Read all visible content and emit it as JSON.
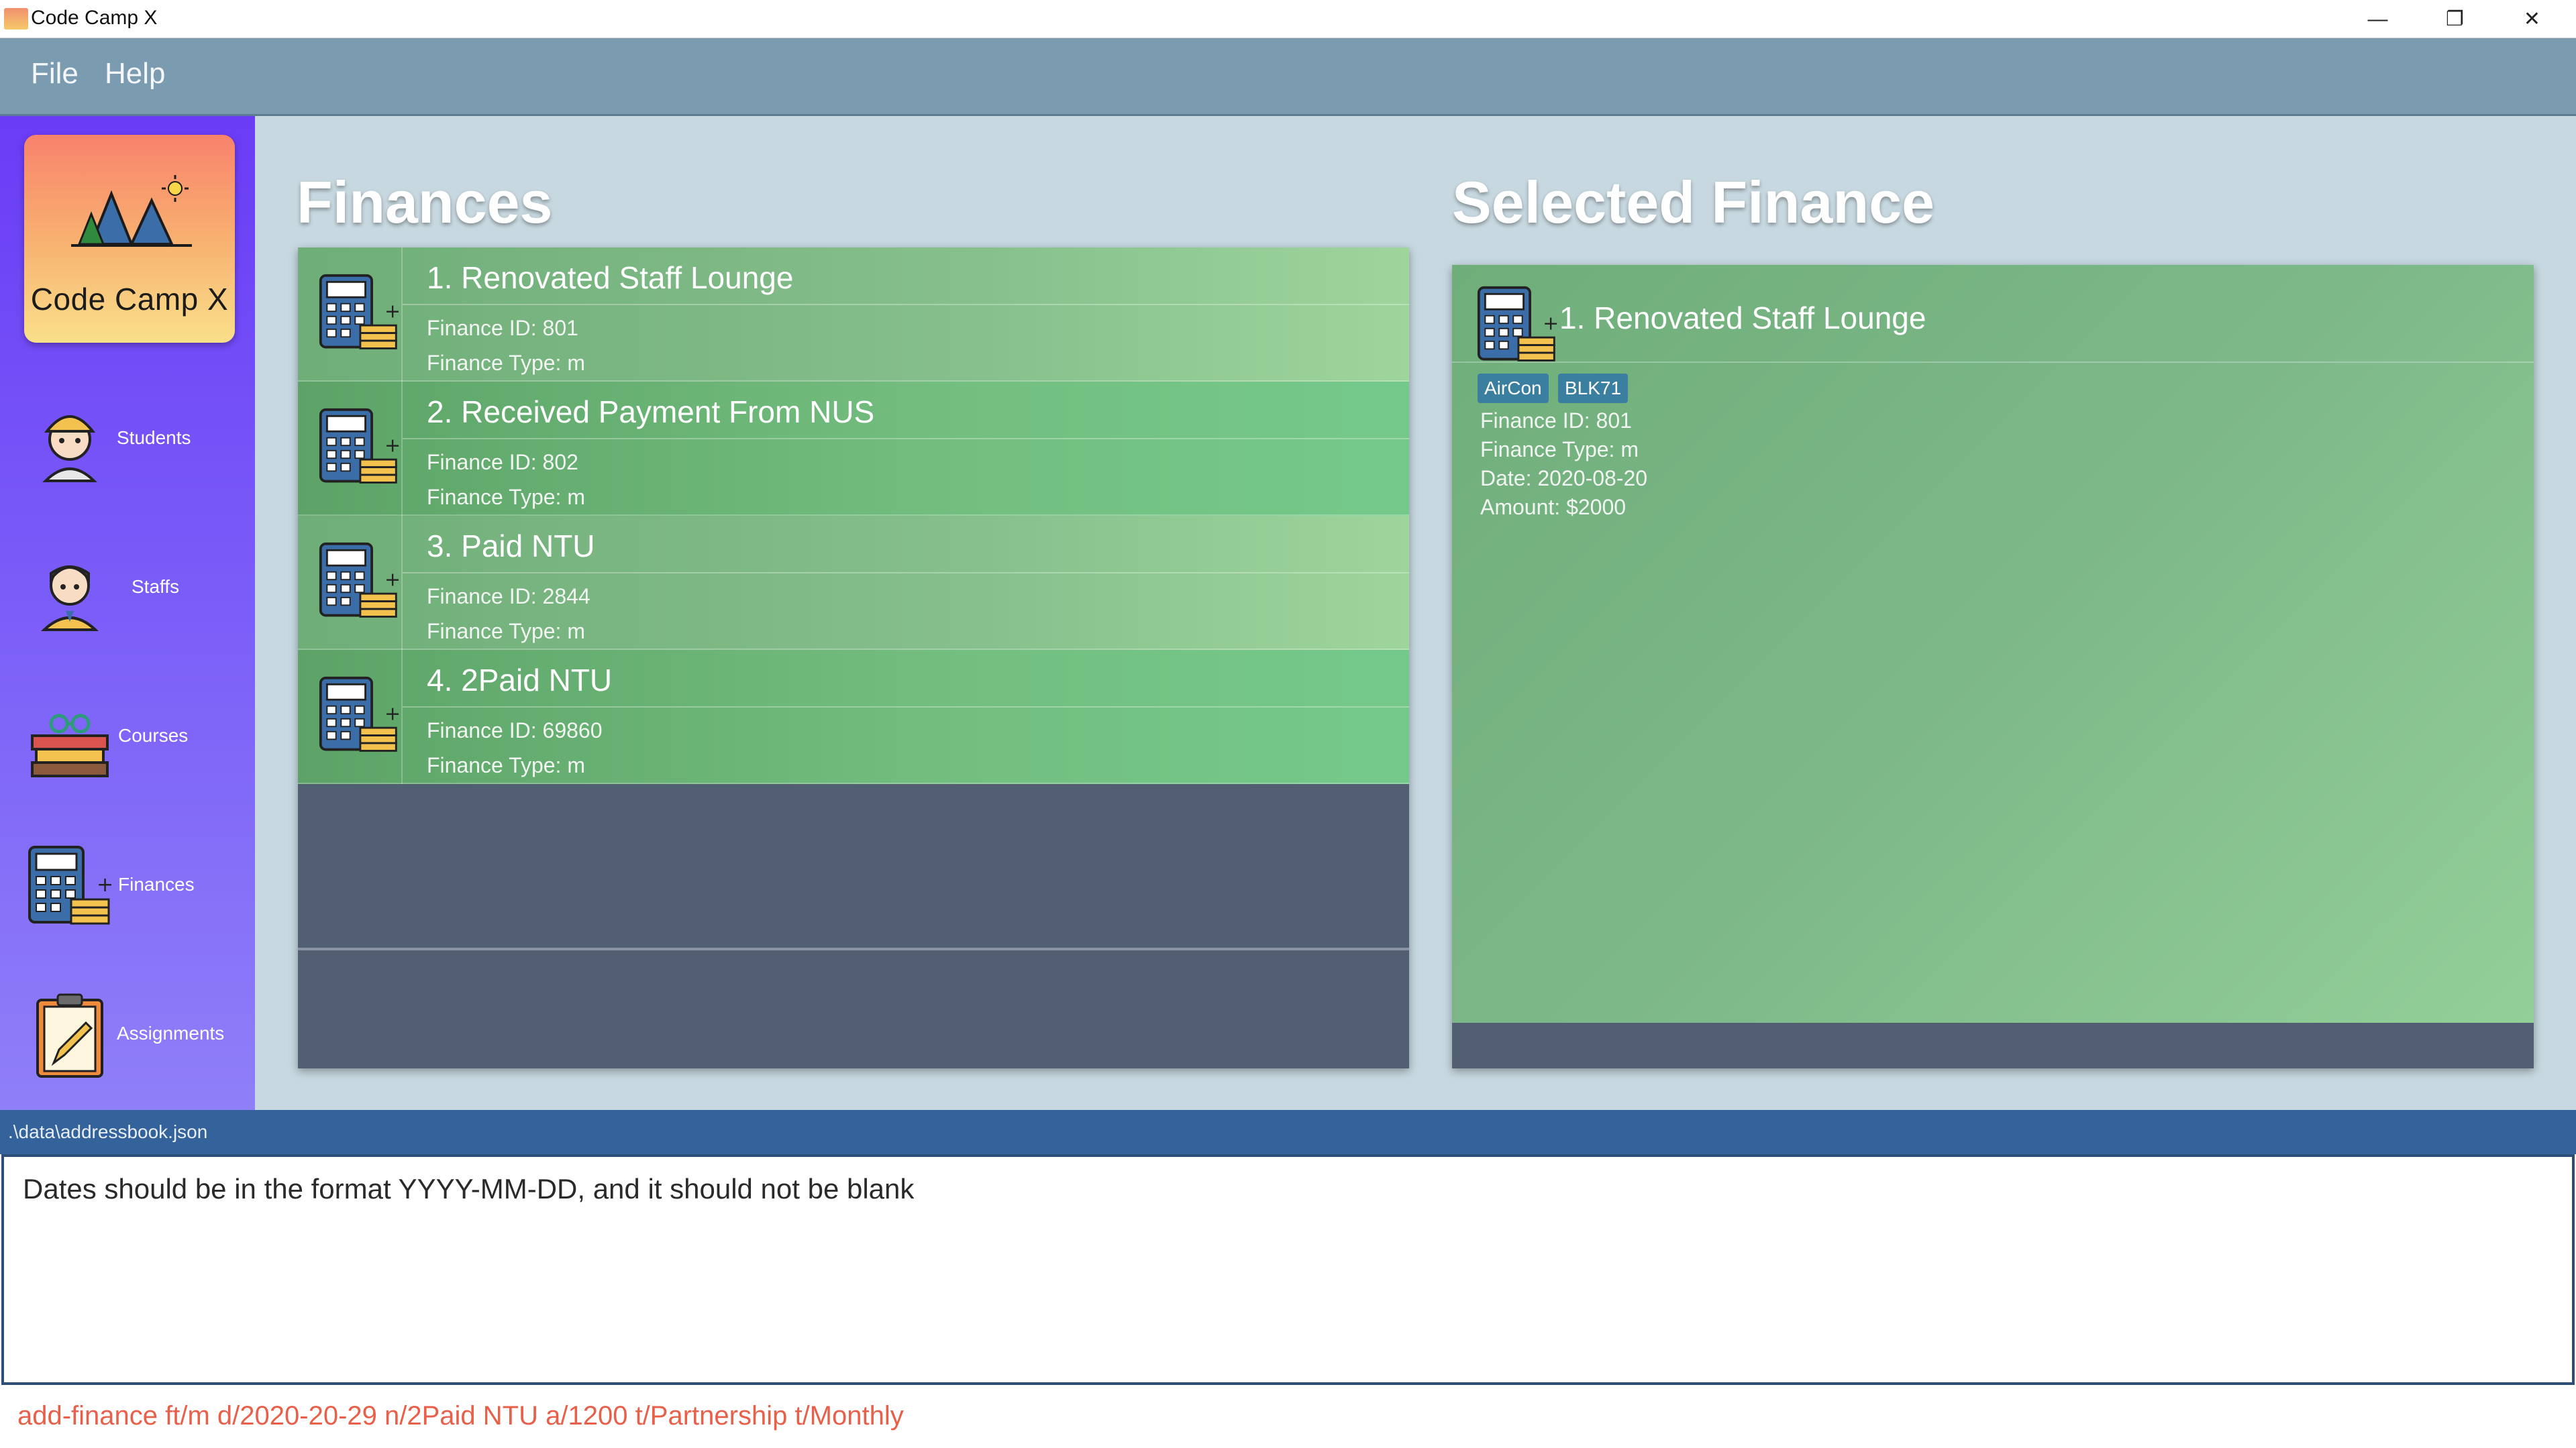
{
  "window": {
    "title": "Code Camp X",
    "icon": "app-icon",
    "controls": [
      "minimize",
      "restore",
      "close"
    ]
  },
  "menu": {
    "file_label": "File",
    "help_label": "Help"
  },
  "sidebar": {
    "logo_text": "Code Camp X",
    "items": [
      {
        "label": "Students",
        "icon": "student-icon"
      },
      {
        "label": "Staffs",
        "icon": "staff-icon"
      },
      {
        "label": "Courses",
        "icon": "books-icon"
      },
      {
        "label": "Finances",
        "icon": "calculator-icon"
      },
      {
        "label": "Assignments",
        "icon": "clipboard-icon"
      }
    ]
  },
  "finances_panel": {
    "title": "Finances",
    "items": [
      {
        "title": "1. Renovated Staff Lounge",
        "id_line": "Finance ID:  801",
        "type_line": "Finance Type: m"
      },
      {
        "title": "2. Received Payment From NUS",
        "id_line": "Finance ID:  802",
        "type_line": "Finance Type: m"
      },
      {
        "title": "3. Paid NTU",
        "id_line": "Finance ID:  2844",
        "type_line": "Finance Type: m"
      },
      {
        "title": "4. 2Paid NTU",
        "id_line": "Finance ID:  69860",
        "type_line": "Finance Type: m"
      }
    ]
  },
  "selected_panel": {
    "title": "Selected Finance",
    "item_title": "1.  Renovated Staff Lounge",
    "tags": [
      "AirCon",
      "BLK71"
    ],
    "id_line": "Finance ID: 801",
    "type_line": "Finance Type: m",
    "date_line": "Date: 2020-08-20",
    "amount_line": "Amount: $2000"
  },
  "status": {
    "file_path": ".\\data\\addressbook.json"
  },
  "result": {
    "message": "Dates should be in the format YYYY-MM-DD, and it should not be blank"
  },
  "command": {
    "value": "add-finance ft/m d/2020-20-29 n/2Paid NTU a/1200 t/Partnership t/Monthly"
  },
  "colors": {
    "menubar": "#7b9bb1",
    "sidebar_top": "#6a3cf6",
    "row_green": "#6fae78",
    "status_bar": "#34629a",
    "command_text": "#e8604a"
  }
}
